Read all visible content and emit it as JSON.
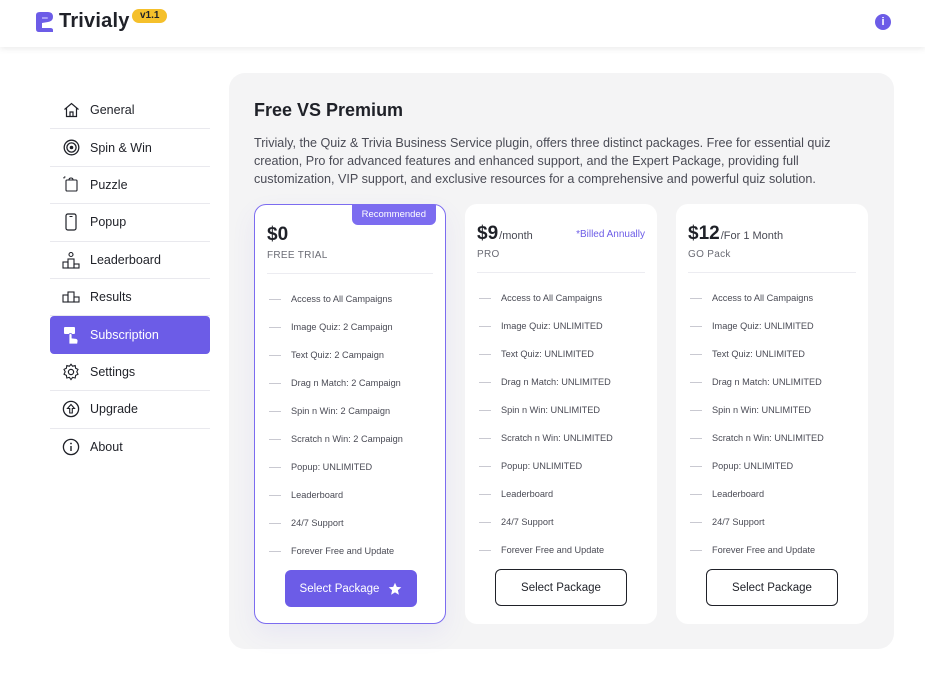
{
  "header": {
    "logo_text": "Trivialy",
    "version": "v1.1",
    "info_icon": "i"
  },
  "sidebar": {
    "items": [
      {
        "label": "General",
        "icon": "home-icon"
      },
      {
        "label": "Spin & Win",
        "icon": "target-icon"
      },
      {
        "label": "Puzzle",
        "icon": "puzzle-icon"
      },
      {
        "label": "Popup",
        "icon": "phone-icon"
      },
      {
        "label": "Leaderboard",
        "icon": "podium-icon"
      },
      {
        "label": "Results",
        "icon": "results-icon"
      },
      {
        "label": "Subscription",
        "icon": "subscription-icon"
      },
      {
        "label": "Settings",
        "icon": "gear-icon"
      },
      {
        "label": "Upgrade",
        "icon": "upgrade-icon"
      },
      {
        "label": "About",
        "icon": "info-icon"
      }
    ],
    "active": "Subscription"
  },
  "main": {
    "title": "Free VS Premium",
    "description": "Trivialy, the Quiz & Trivia Business Service plugin, offers three distinct packages. Free for essential quiz creation, Pro for advanced features and enhanced support, and the Expert Package, providing full customization, VIP support, and exclusive resources for a comprehensive and powerful quiz solution.",
    "plans": [
      {
        "price": "$0",
        "period": "",
        "billed": "",
        "badge": "Recommended",
        "name": "FREE TRIAL",
        "features": [
          "Access to All Campaigns",
          "Image Quiz: 2 Campaign",
          "Text Quiz: 2 Campaign",
          "Drag n Match: 2 Campaign",
          "Spin n Win: 2 Campaign",
          "Scratch n Win: 2 Campaign",
          "Popup: UNLIMITED",
          "Leaderboard",
          "24/7 Support",
          "Forever Free and Update"
        ],
        "button": "Select Package"
      },
      {
        "price": "$9",
        "period": "/month",
        "billed": "*Billed Annually",
        "badge": "",
        "name": "PRO",
        "features": [
          "Access to All Campaigns",
          "Image Quiz: UNLIMITED",
          "Text Quiz: UNLIMITED",
          "Drag n Match: UNLIMITED",
          "Spin n Win: UNLIMITED",
          "Scratch n Win: UNLIMITED",
          "Popup: UNLIMITED",
          "Leaderboard",
          "24/7 Support",
          "Forever Free and Update"
        ],
        "button": "Select Package"
      },
      {
        "price": "$12",
        "period": "/For 1 Month",
        "billed": "",
        "badge": "",
        "name": "GO Pack",
        "features": [
          "Access to All Campaigns",
          "Image Quiz: UNLIMITED",
          "Text Quiz: UNLIMITED",
          "Drag n Match: UNLIMITED",
          "Spin n Win: UNLIMITED",
          "Scratch n Win: UNLIMITED",
          "Popup: UNLIMITED",
          "Leaderboard",
          "24/7 Support",
          "Forever Free and Update"
        ],
        "button": "Select Package"
      }
    ]
  },
  "colors": {
    "accent": "#6c5ce7",
    "badge": "#f5c02b",
    "panel_bg": "#f4f4f5"
  }
}
